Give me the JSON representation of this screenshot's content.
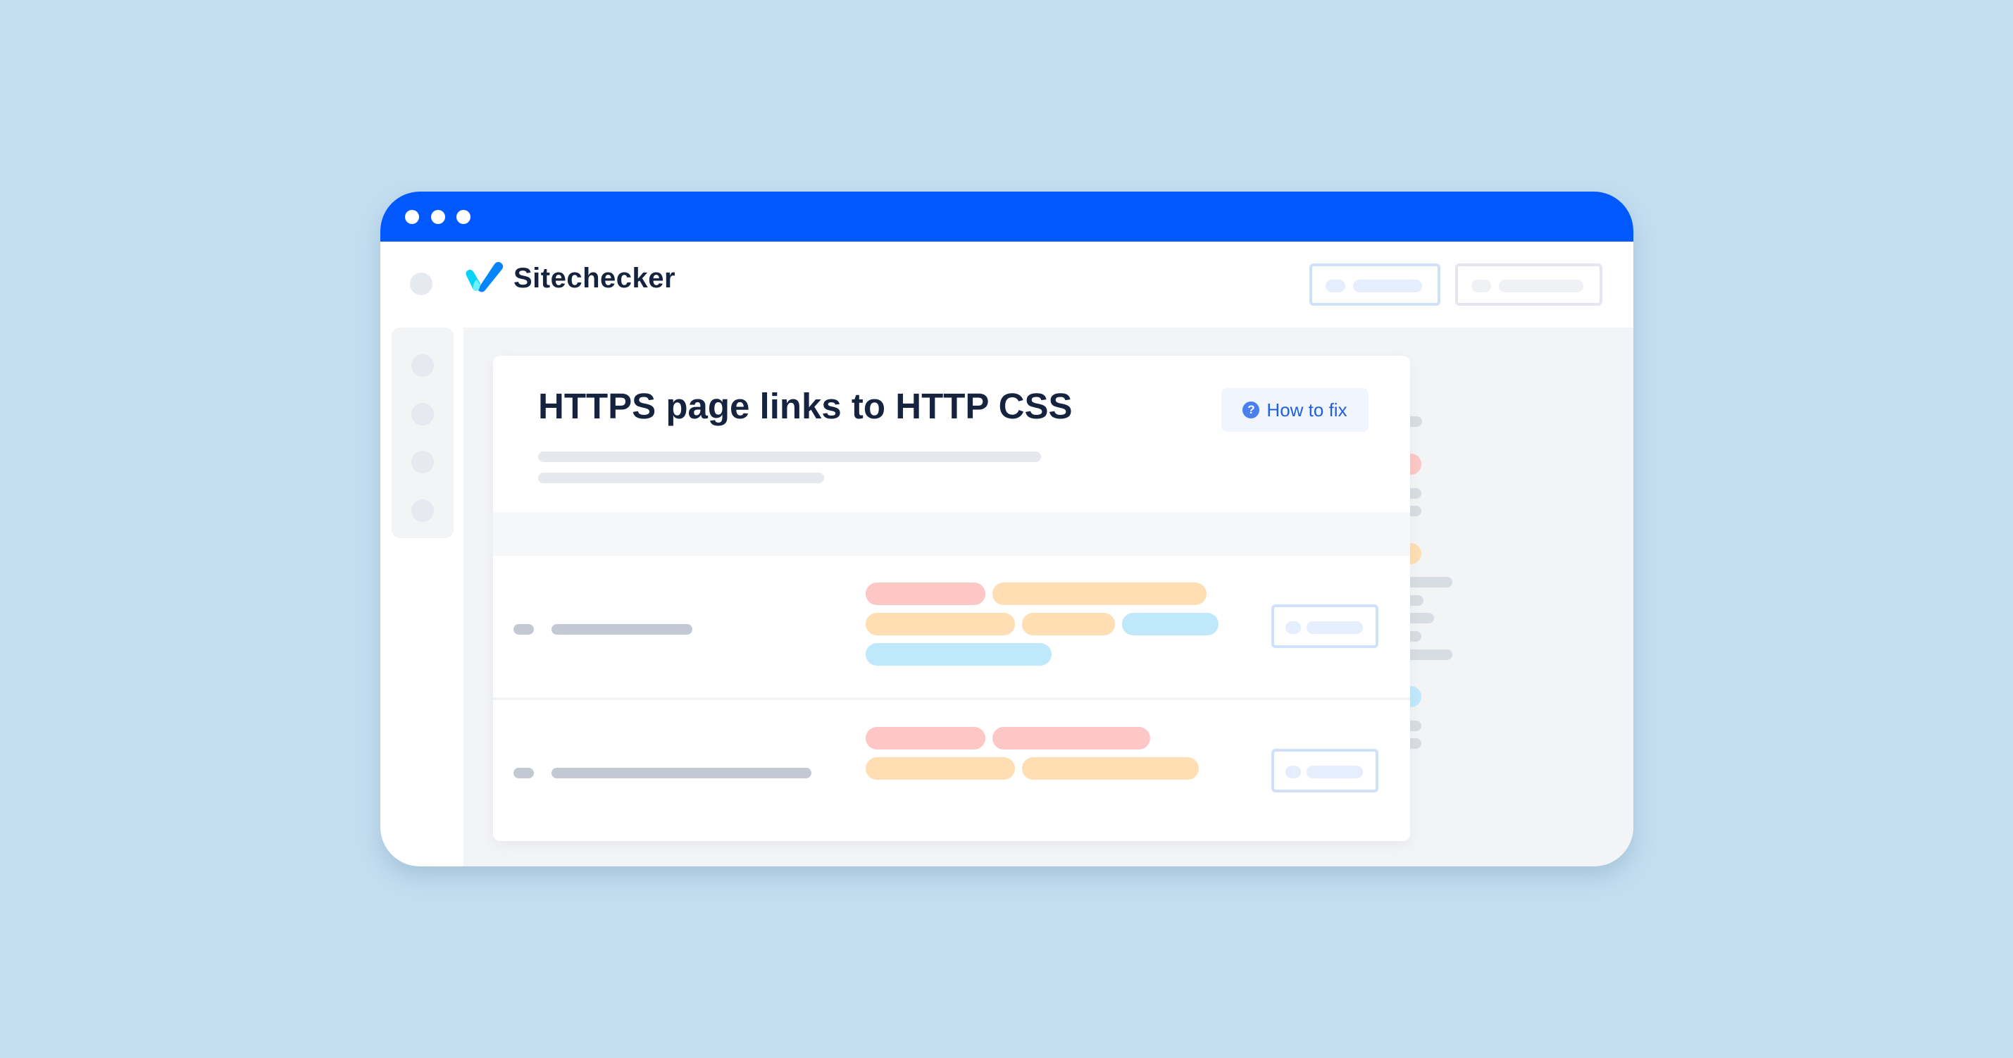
{
  "window": {
    "titlebar_dots": [
      "close",
      "minimize",
      "maximize"
    ]
  },
  "header": {
    "logo_icon": "sitechecker-checkmark-logo",
    "brand_name": "Sitechecker",
    "buttons": [
      {
        "name": "primary-placeholder-button"
      },
      {
        "name": "secondary-placeholder-button"
      }
    ]
  },
  "sidebar": {
    "items": [
      {
        "name": "sidebar-item-1"
      },
      {
        "name": "sidebar-item-2"
      },
      {
        "name": "sidebar-item-3"
      },
      {
        "name": "sidebar-item-4"
      }
    ]
  },
  "main": {
    "title": "HTTPS page links to HTTP CSS",
    "how_to_fix_label": "How to fix",
    "how_to_fix_icon": "question-circle-icon",
    "rows": [
      {
        "tags": [
          "critical",
          "warning",
          "warning",
          "warning",
          "info",
          "info"
        ]
      },
      {
        "tags": [
          "critical",
          "critical",
          "warning",
          "warning"
        ]
      }
    ]
  },
  "right_panel": {
    "groups": [
      {
        "badge": "neutral"
      },
      {
        "badge": "critical"
      },
      {
        "badge": "warning"
      },
      {
        "badge": "info"
      }
    ]
  },
  "colors": {
    "background": "#c4def0",
    "titlebar": "#0159fe",
    "title_text": "#15233f",
    "link": "#1f5fe0",
    "critical": "#fcc7c4",
    "warning": "#fedeb2",
    "info": "#c0e8fc"
  }
}
